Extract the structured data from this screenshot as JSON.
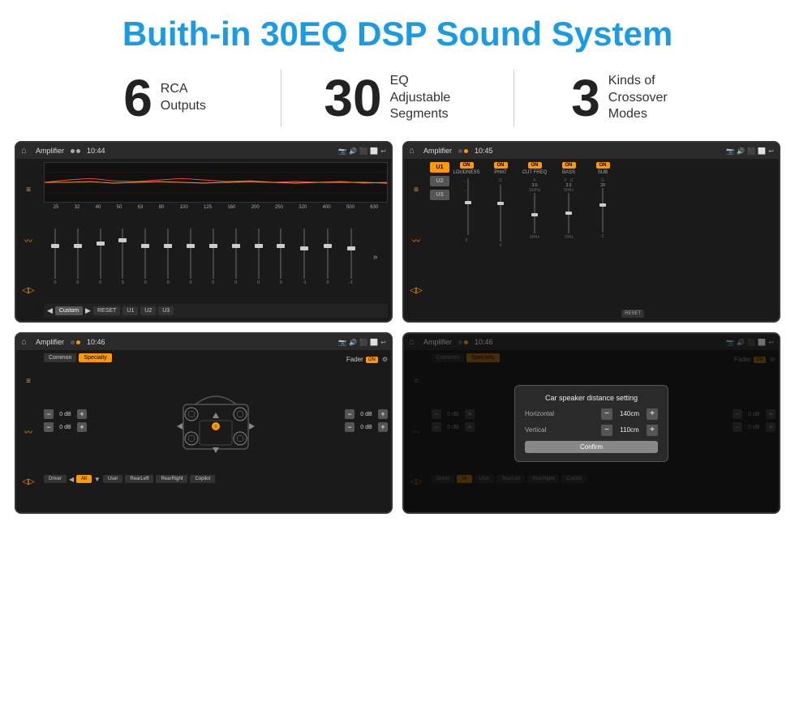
{
  "page": {
    "title": "Buith-in 30EQ DSP Sound System",
    "stats": [
      {
        "number": "6",
        "text": "RCA\nOutputs"
      },
      {
        "number": "30",
        "text": "EQ Adjustable\nSegments"
      },
      {
        "number": "3",
        "text": "Kinds of\nCrossover Modes"
      }
    ]
  },
  "screens": [
    {
      "id": "screen1",
      "title": "Amplifier",
      "time": "10:44",
      "type": "eq",
      "eq_labels": [
        "25",
        "32",
        "40",
        "50",
        "63",
        "80",
        "100",
        "125",
        "160",
        "200",
        "250",
        "320",
        "400",
        "500",
        "630"
      ],
      "eq_values": [
        "0",
        "0",
        "0",
        "5",
        "0",
        "0",
        "0",
        "0",
        "0",
        "0",
        "0",
        "-1",
        "0",
        "-1"
      ],
      "bottom_buttons": [
        "Custom",
        "RESET",
        "U1",
        "U2",
        "U3"
      ]
    },
    {
      "id": "screen2",
      "title": "Amplifier",
      "time": "10:45",
      "type": "amp",
      "u_buttons": [
        "U1",
        "U2",
        "U3"
      ],
      "controls": [
        {
          "label": "LOUDNESS",
          "on": true
        },
        {
          "label": "PHAT",
          "on": true
        },
        {
          "label": "CUT FREQ",
          "on": true
        },
        {
          "label": "BASS",
          "on": true
        },
        {
          "label": "SUB",
          "on": true
        }
      ]
    },
    {
      "id": "screen3",
      "title": "Amplifier",
      "time": "10:46",
      "type": "fader",
      "tabs": [
        "Common",
        "Specialty"
      ],
      "active_tab": "Specialty",
      "fader_label": "Fader",
      "fader_on": "ON",
      "db_values": [
        "0 dB",
        "0 dB",
        "0 dB",
        "0 dB"
      ],
      "bottom_buttons": [
        "Driver",
        "All",
        "User",
        "RearLeft",
        "RearRight",
        "Copilot"
      ]
    },
    {
      "id": "screen4",
      "title": "Amplifier",
      "time": "10:46",
      "type": "fader_dialog",
      "tabs": [
        "Common",
        "Specialty"
      ],
      "dialog": {
        "title": "Car speaker distance setting",
        "rows": [
          {
            "label": "Horizontal",
            "value": "140cm"
          },
          {
            "label": "Vertical",
            "value": "110cm"
          }
        ],
        "confirm_label": "Confirm"
      }
    }
  ]
}
